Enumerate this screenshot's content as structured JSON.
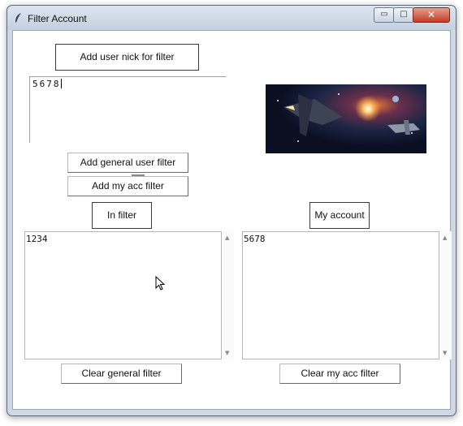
{
  "window": {
    "title": "Filter Account"
  },
  "titlebar_buttons": {
    "minimize": "▭",
    "maximize": "□",
    "close": "✕"
  },
  "buttons": {
    "add_user_nick": "Add user nick for filter",
    "add_general_user_filter": "Add general user filter",
    "add_my_acc_filter": "Add my acc filter",
    "in_filter": "In filter",
    "my_account": "My account",
    "clear_general_filter": "Clear general filter",
    "clear_my_acc_filter": "Clear my acc filter"
  },
  "entry": {
    "value": "5678"
  },
  "lists": {
    "in_filter_items": [
      "1234"
    ],
    "my_account_items": [
      "5678"
    ]
  },
  "scroll_arrows": {
    "up": "▲",
    "down": "▼"
  },
  "colors": {
    "titlebar": "#c3d0de",
    "close_button": "#c43a22",
    "client_bg": "#ffffff"
  },
  "icons": [
    "feather-icon",
    "space-ship-image",
    "mouse-pointer-icon"
  ]
}
